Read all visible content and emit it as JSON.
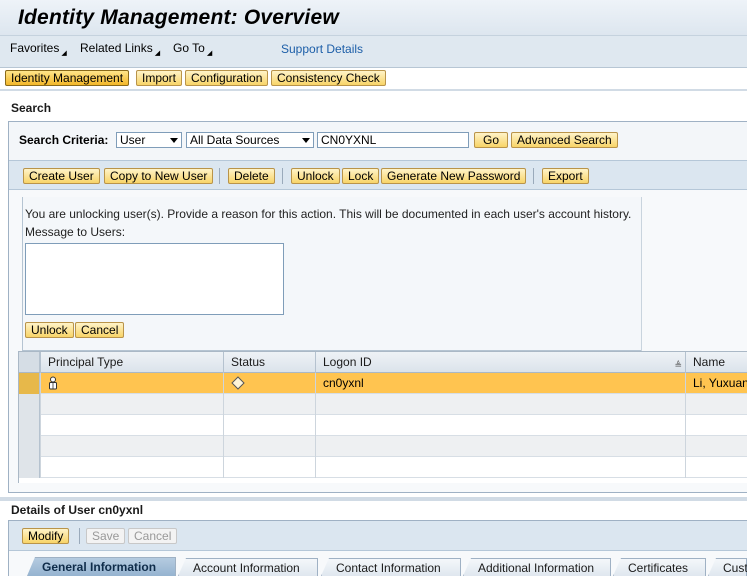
{
  "window": {
    "title": "Identity Management: Overview"
  },
  "menu": {
    "favorites": "Favorites",
    "related_links": "Related Links",
    "go_to": "Go To",
    "support_details": "Support Details"
  },
  "nav": {
    "identity_management": "Identity Management",
    "import": "Import",
    "configuration": "Configuration",
    "consistency_check": "Consistency Check"
  },
  "search": {
    "section_title": "Search",
    "criteria_label": "Search Criteria:",
    "type_value": "User",
    "source_value": "All Data Sources",
    "query_value": "CN0YXNL",
    "go_label": "Go",
    "advanced_label": "Advanced Search"
  },
  "toolbar": {
    "create_user": "Create User",
    "copy_to_new_user": "Copy to New User",
    "delete": "Delete",
    "unlock": "Unlock",
    "lock": "Lock",
    "generate_new_password": "Generate New Password",
    "export": "Export"
  },
  "unlock_dialog": {
    "instruction": "You are unlocking user(s). Provide a reason for this action. This will be documented in each user's account history.",
    "message_label": "Message to Users:",
    "message_value": "",
    "unlock_label": "Unlock",
    "cancel_label": "Cancel"
  },
  "results": {
    "columns": [
      "Principal Type",
      "Status",
      "Logon ID",
      "Name"
    ],
    "rows": [
      {
        "principal_type_icon": "user-icon",
        "status_icon": "diamond-status-icon",
        "logon_id": "cn0yxnl",
        "name": "Li, Yuxuan"
      }
    ]
  },
  "details": {
    "title": "Details of User cn0yxnl",
    "modify": "Modify",
    "save": "Save",
    "cancel": "Cancel",
    "tabs": [
      "General Information",
      "Account Information",
      "Contact Information",
      "Additional Information",
      "Certificates",
      "Cust"
    ]
  },
  "colors": {
    "button_yellow": "#f8d468",
    "selected_row": "#ffc450",
    "active_tab": "#95b3d0",
    "link_blue": "#1c5ea8"
  }
}
